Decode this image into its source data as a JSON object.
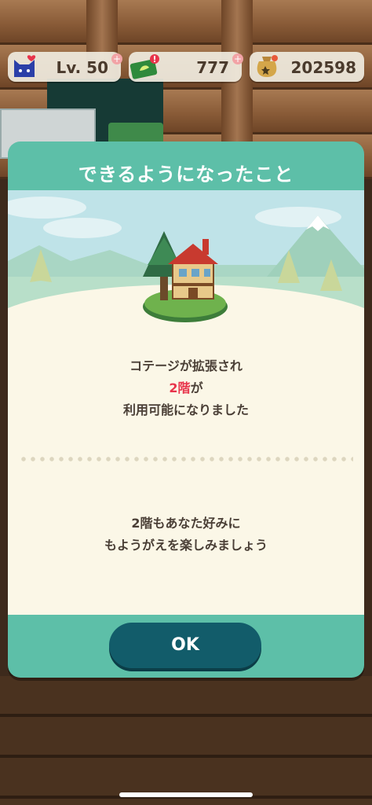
{
  "hud": {
    "level_label": "Lv. 50",
    "tickets": "777",
    "bells": "202598",
    "plus": "+",
    "icons": [
      "cat-head-icon",
      "leaf-ticket-icon",
      "bell-bag-icon"
    ]
  },
  "modal": {
    "title": "できるようになったこと",
    "message1": {
      "line1": "コテージが拡張され",
      "line2_highlight": "2階",
      "line2_rest": "が",
      "line3": "利用可能になりました"
    },
    "message2": {
      "line1": "2階もあなた好みに",
      "line2": "もようがえを楽しみましょう"
    },
    "ok_label": "OK"
  },
  "colors": {
    "teal": "#5dbfa8",
    "button": "#125c6a",
    "highlight": "#e8344b",
    "cream": "#fbf7e7"
  }
}
